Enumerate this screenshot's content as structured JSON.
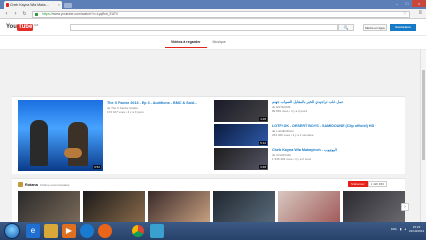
{
  "browser": {
    "tab_title": "Cheb Kayna Wla Maks…",
    "tab_close": "×",
    "url_scheme": "https://",
    "url_rest": "www.youtube.com/watch?v=LyqBnt_EATV",
    "controls": {
      "minimize": "–",
      "maximize": "□",
      "close": "×"
    },
    "nav": {
      "back": "‹",
      "forward": "›",
      "reload": "↻"
    }
  },
  "youtube": {
    "logo_you": "You",
    "logo_tube": "Tube",
    "logo_region": "DZ",
    "search_button": "🔍",
    "upload_label": "Mettre en ligne",
    "signin_label": "Connexion",
    "tabs": [
      "Vidéos à regarder",
      "Musique"
    ]
  },
  "featured": {
    "title": "The X Factor 2013 - Ep 3 - Auditions - BMC & Said...",
    "channel": "de The X Factor Arabia",
    "stats": "170 107 vues • il y a 3 jours",
    "duration": "9:52"
  },
  "side_videos": [
    {
      "title": "عمل غلب تراجيدي الخبر بالمقابل الصواب جهنم",
      "meta1": "de ESTEUMZ",
      "meta2": "89 881 vues • il y a 3 jours",
      "duration": "4:28"
    },
    {
      "title": "LOTFI DK - DESERT BOYS - SAMIDOUNE (Clip officiel) HD",
      "meta1": "de Lotfidkofficiel",
      "meta2": "253 020 vues • il y a 1 semaine",
      "duration": "5:12"
    },
    {
      "title": "Cheb Kayna Wla Makayinch - اليوتيوب",
      "meta1": "de ChebKhalil",
      "meta2": "1 546 462 vues • il y a 2 mois",
      "duration": "3:48"
    }
  ],
  "channel_section": {
    "name": "Rotana",
    "subtitle": "Chaîne recommandée",
    "subscribe_label": "S'abonner",
    "subscriber_count": "1 420 963",
    "next_arrow": "›"
  },
  "taskbar": {
    "time": "15:23",
    "date": "22/10/2013",
    "lang": "FRA",
    "icons": [
      "ie-icon",
      "folder-icon",
      "media-icon",
      "hp-icon",
      "firefox-icon",
      "chrome-icon",
      "paint-icon"
    ]
  },
  "colors": {
    "accent": "#e62117",
    "link": "#167ac6",
    "signin": "#167ac6"
  }
}
